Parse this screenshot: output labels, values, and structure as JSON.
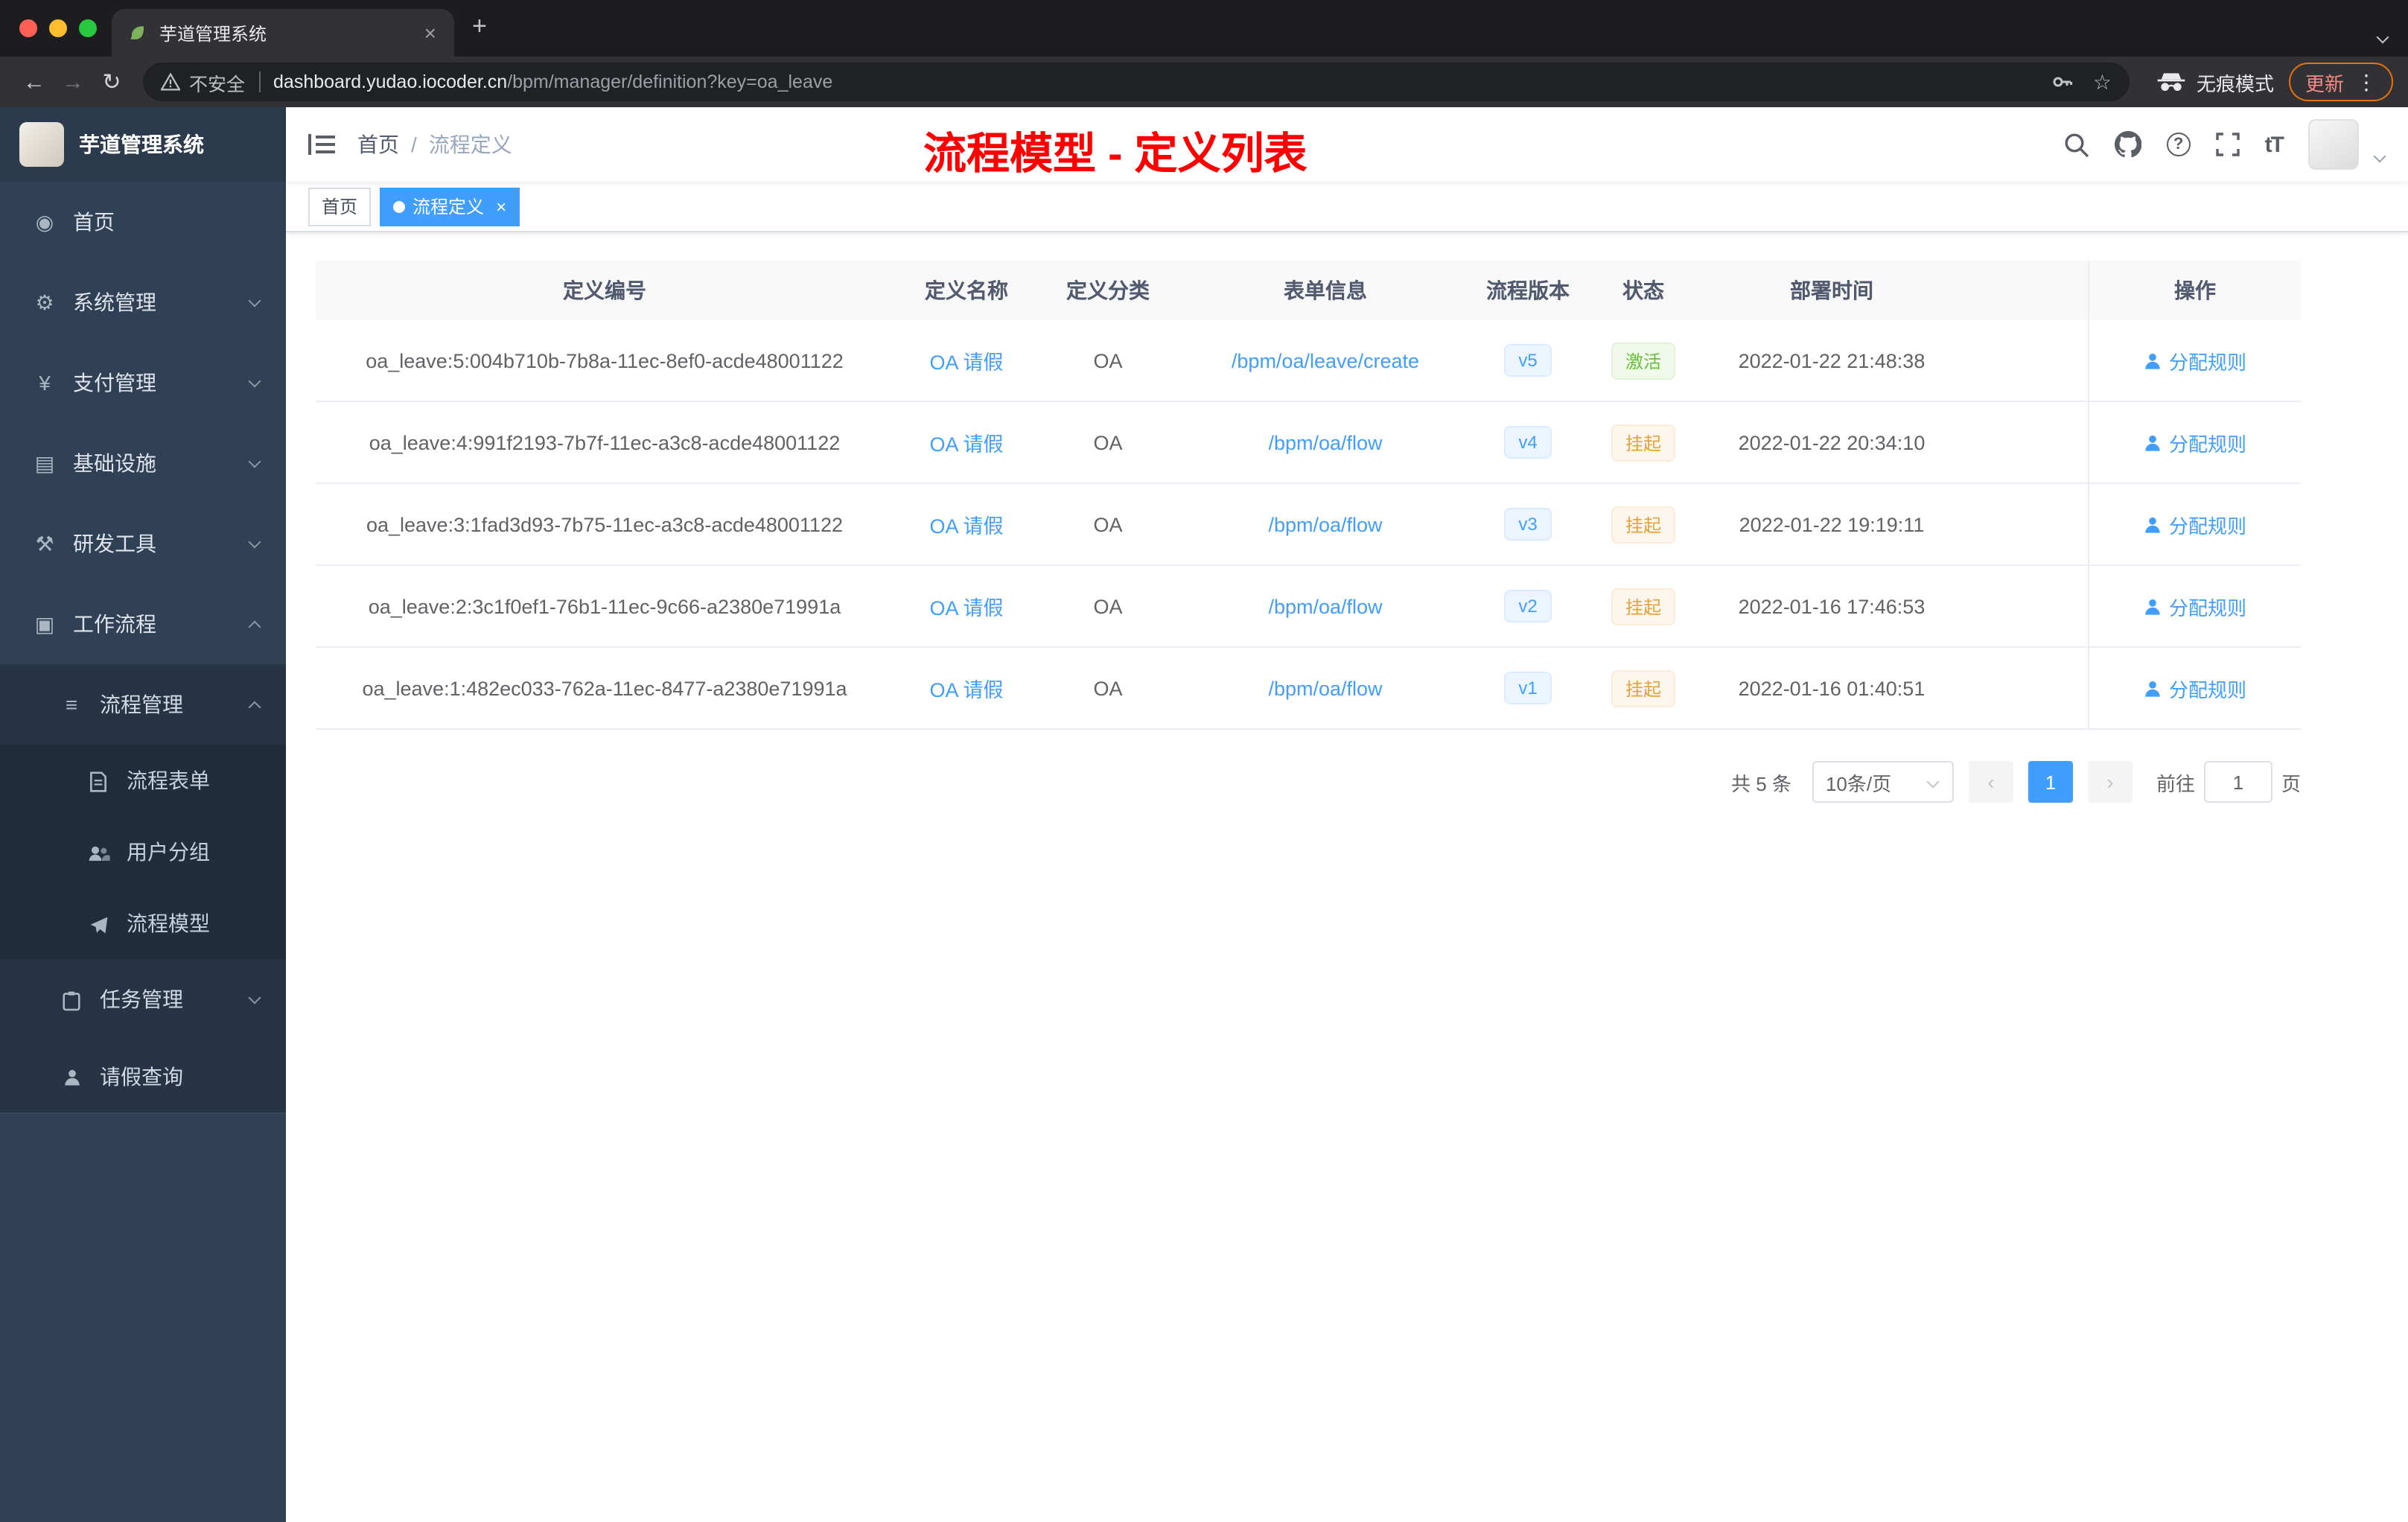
{
  "browser": {
    "tab_title": "芋道管理系统",
    "new_tab_icon": "+",
    "tab_close_icon": "×",
    "nav": {
      "back": "←",
      "forward": "→",
      "reload": "↻"
    },
    "address": {
      "security_label": "不安全",
      "host": "dashboard.yudao.iocoder.cn",
      "path": "/bpm/manager/definition?key=oa_leave",
      "star_icon": "☆"
    },
    "incognito_label": "无痕模式",
    "update_label": "更新",
    "menu_icon": "⋮"
  },
  "sidebar": {
    "logo_title": "芋道管理系统",
    "items": [
      {
        "label": "首页",
        "icon": "dashboard-icon"
      },
      {
        "label": "系统管理",
        "icon": "gear-icon"
      },
      {
        "label": "支付管理",
        "icon": "yen-icon"
      },
      {
        "label": "基础设施",
        "icon": "infrastructure-icon"
      },
      {
        "label": "研发工具",
        "icon": "tools-icon"
      },
      {
        "label": "工作流程",
        "icon": "workflow-icon"
      },
      {
        "label": "流程管理",
        "icon": "process-management-icon"
      },
      {
        "label": "流程表单",
        "icon": "form-icon"
      },
      {
        "label": "用户分组",
        "icon": "user-group-icon"
      },
      {
        "label": "流程模型",
        "icon": "process-model-icon"
      },
      {
        "label": "任务管理",
        "icon": "task-management-icon"
      },
      {
        "label": "请假查询",
        "icon": "person-icon"
      }
    ]
  },
  "header": {
    "breadcrumb": {
      "home": "首页",
      "separator": "/",
      "current": "流程定义"
    },
    "page_title": "流程模型 - 定义列表",
    "icons": {
      "question": "?",
      "font_size": "tT"
    }
  },
  "tags": {
    "home": "首页",
    "active": "流程定义",
    "close_icon": "×"
  },
  "table": {
    "columns": {
      "id": "定义编号",
      "name": "定义名称",
      "category": "定义分类",
      "form": "表单信息",
      "version": "流程版本",
      "status": "状态",
      "deploy_time": "部署时间",
      "action": "操作"
    },
    "rows": [
      {
        "id": "oa_leave:5:004b710b-7b8a-11ec-8ef0-acde48001122",
        "name": "OA 请假",
        "category": "OA",
        "form": "/bpm/oa/leave/create",
        "version": "v5",
        "status": "激活",
        "status_type": "success",
        "deploy_time": "2022-01-22 21:48:38",
        "action": "分配规则"
      },
      {
        "id": "oa_leave:4:991f2193-7b7f-11ec-a3c8-acde48001122",
        "name": "OA 请假",
        "category": "OA",
        "form": "/bpm/oa/flow",
        "version": "v4",
        "status": "挂起",
        "status_type": "warning",
        "deploy_time": "2022-01-22 20:34:10",
        "action": "分配规则"
      },
      {
        "id": "oa_leave:3:1fad3d93-7b75-11ec-a3c8-acde48001122",
        "name": "OA 请假",
        "category": "OA",
        "form": "/bpm/oa/flow",
        "version": "v3",
        "status": "挂起",
        "status_type": "warning",
        "deploy_time": "2022-01-22 19:19:11",
        "action": "分配规则"
      },
      {
        "id": "oa_leave:2:3c1f0ef1-76b1-11ec-9c66-a2380e71991a",
        "name": "OA 请假",
        "category": "OA",
        "form": "/bpm/oa/flow",
        "version": "v2",
        "status": "挂起",
        "status_type": "warning",
        "deploy_time": "2022-01-16 17:46:53",
        "action": "分配规则"
      },
      {
        "id": "oa_leave:1:482ec033-762a-11ec-8477-a2380e71991a",
        "name": "OA 请假",
        "category": "OA",
        "form": "/bpm/oa/flow",
        "version": "v1",
        "status": "挂起",
        "status_type": "warning",
        "deploy_time": "2022-01-16 01:40:51",
        "action": "分配规则"
      }
    ]
  },
  "pagination": {
    "total": "共 5 条",
    "page_size": "10条/页",
    "prev_icon": "‹",
    "next_icon": "›",
    "current_page": "1",
    "goto_prefix": "前往",
    "goto_value": "1",
    "goto_suffix": "页"
  }
}
